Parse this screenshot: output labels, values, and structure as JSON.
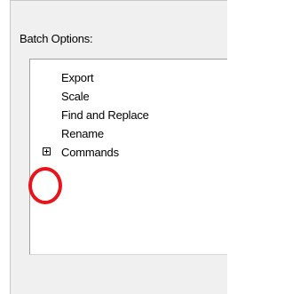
{
  "batch_options": {
    "title": "Batch Options:",
    "items": [
      {
        "label": "Export",
        "expandable": false
      },
      {
        "label": "Scale",
        "expandable": false
      },
      {
        "label": "Find and Replace",
        "expandable": false
      },
      {
        "label": "Rename",
        "expandable": false
      },
      {
        "label": "Commands",
        "expandable": true,
        "expanded": false
      }
    ]
  },
  "colors": {
    "panel_background": "#f0f0f0",
    "list_background": "#ffffff",
    "highlight_ring": "#e8131b"
  },
  "icons": {
    "expander": "plus-box-icon"
  }
}
